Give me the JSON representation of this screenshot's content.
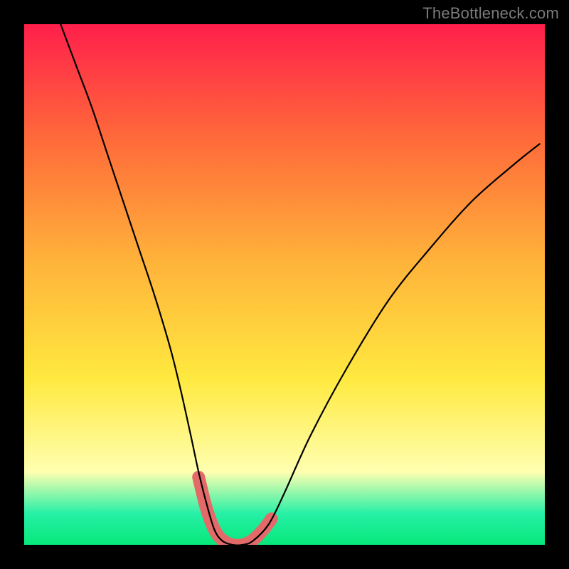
{
  "watermark": "TheBottleneck.com",
  "colors": {
    "frame": "#000000",
    "gradient_top": "#ff1f4b",
    "gradient_mid1": "#ff6a3a",
    "gradient_mid2": "#ffb13a",
    "gradient_mid3": "#ffe93f",
    "gradient_pale": "#ffffb0",
    "gradient_teal": "#26f0a6",
    "gradient_green": "#07e87b",
    "curve": "#000000",
    "marker": "#e46a6a"
  },
  "chart_data": {
    "type": "line",
    "title": "",
    "xlabel": "",
    "ylabel": "",
    "xlim": [
      0,
      100
    ],
    "ylim": [
      0,
      100
    ],
    "grid": false,
    "series": [
      {
        "name": "bottleneck-curve",
        "x": [
          7,
          10,
          13,
          16,
          19,
          22,
          25,
          28,
          30,
          32,
          33.5,
          35,
          36.5,
          38,
          40,
          42,
          44,
          47,
          50,
          55,
          62,
          70,
          78,
          86,
          94,
          99
        ],
        "values": [
          100,
          92,
          84,
          75,
          66,
          57,
          48,
          38,
          30,
          21,
          14,
          8,
          3,
          0.8,
          0,
          0,
          0.8,
          4,
          10,
          21,
          34,
          47,
          57,
          66,
          73,
          77
        ]
      }
    ],
    "markers": {
      "name": "highlighted-band",
      "x": [
        33.5,
        35,
        36.5,
        38,
        40,
        42,
        44,
        46,
        47.5
      ],
      "values": [
        13,
        7,
        3,
        1,
        0,
        0,
        1,
        3,
        5
      ]
    },
    "annotations": []
  }
}
